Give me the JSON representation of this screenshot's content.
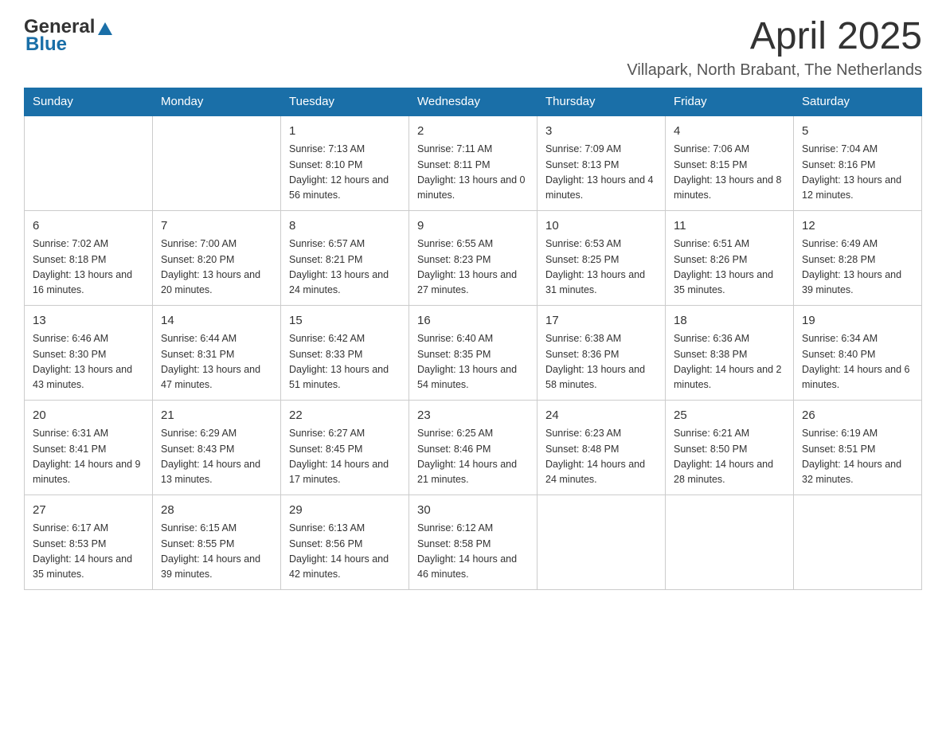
{
  "header": {
    "logo_general": "General",
    "logo_blue": "Blue",
    "month": "April 2025",
    "location": "Villapark, North Brabant, The Netherlands"
  },
  "days_of_week": [
    "Sunday",
    "Monday",
    "Tuesday",
    "Wednesday",
    "Thursday",
    "Friday",
    "Saturday"
  ],
  "weeks": [
    [
      {
        "day": "",
        "sunrise": "",
        "sunset": "",
        "daylight": ""
      },
      {
        "day": "",
        "sunrise": "",
        "sunset": "",
        "daylight": ""
      },
      {
        "day": "1",
        "sunrise": "Sunrise: 7:13 AM",
        "sunset": "Sunset: 8:10 PM",
        "daylight": "Daylight: 12 hours and 56 minutes."
      },
      {
        "day": "2",
        "sunrise": "Sunrise: 7:11 AM",
        "sunset": "Sunset: 8:11 PM",
        "daylight": "Daylight: 13 hours and 0 minutes."
      },
      {
        "day": "3",
        "sunrise": "Sunrise: 7:09 AM",
        "sunset": "Sunset: 8:13 PM",
        "daylight": "Daylight: 13 hours and 4 minutes."
      },
      {
        "day": "4",
        "sunrise": "Sunrise: 7:06 AM",
        "sunset": "Sunset: 8:15 PM",
        "daylight": "Daylight: 13 hours and 8 minutes."
      },
      {
        "day": "5",
        "sunrise": "Sunrise: 7:04 AM",
        "sunset": "Sunset: 8:16 PM",
        "daylight": "Daylight: 13 hours and 12 minutes."
      }
    ],
    [
      {
        "day": "6",
        "sunrise": "Sunrise: 7:02 AM",
        "sunset": "Sunset: 8:18 PM",
        "daylight": "Daylight: 13 hours and 16 minutes."
      },
      {
        "day": "7",
        "sunrise": "Sunrise: 7:00 AM",
        "sunset": "Sunset: 8:20 PM",
        "daylight": "Daylight: 13 hours and 20 minutes."
      },
      {
        "day": "8",
        "sunrise": "Sunrise: 6:57 AM",
        "sunset": "Sunset: 8:21 PM",
        "daylight": "Daylight: 13 hours and 24 minutes."
      },
      {
        "day": "9",
        "sunrise": "Sunrise: 6:55 AM",
        "sunset": "Sunset: 8:23 PM",
        "daylight": "Daylight: 13 hours and 27 minutes."
      },
      {
        "day": "10",
        "sunrise": "Sunrise: 6:53 AM",
        "sunset": "Sunset: 8:25 PM",
        "daylight": "Daylight: 13 hours and 31 minutes."
      },
      {
        "day": "11",
        "sunrise": "Sunrise: 6:51 AM",
        "sunset": "Sunset: 8:26 PM",
        "daylight": "Daylight: 13 hours and 35 minutes."
      },
      {
        "day": "12",
        "sunrise": "Sunrise: 6:49 AM",
        "sunset": "Sunset: 8:28 PM",
        "daylight": "Daylight: 13 hours and 39 minutes."
      }
    ],
    [
      {
        "day": "13",
        "sunrise": "Sunrise: 6:46 AM",
        "sunset": "Sunset: 8:30 PM",
        "daylight": "Daylight: 13 hours and 43 minutes."
      },
      {
        "day": "14",
        "sunrise": "Sunrise: 6:44 AM",
        "sunset": "Sunset: 8:31 PM",
        "daylight": "Daylight: 13 hours and 47 minutes."
      },
      {
        "day": "15",
        "sunrise": "Sunrise: 6:42 AM",
        "sunset": "Sunset: 8:33 PM",
        "daylight": "Daylight: 13 hours and 51 minutes."
      },
      {
        "day": "16",
        "sunrise": "Sunrise: 6:40 AM",
        "sunset": "Sunset: 8:35 PM",
        "daylight": "Daylight: 13 hours and 54 minutes."
      },
      {
        "day": "17",
        "sunrise": "Sunrise: 6:38 AM",
        "sunset": "Sunset: 8:36 PM",
        "daylight": "Daylight: 13 hours and 58 minutes."
      },
      {
        "day": "18",
        "sunrise": "Sunrise: 6:36 AM",
        "sunset": "Sunset: 8:38 PM",
        "daylight": "Daylight: 14 hours and 2 minutes."
      },
      {
        "day": "19",
        "sunrise": "Sunrise: 6:34 AM",
        "sunset": "Sunset: 8:40 PM",
        "daylight": "Daylight: 14 hours and 6 minutes."
      }
    ],
    [
      {
        "day": "20",
        "sunrise": "Sunrise: 6:31 AM",
        "sunset": "Sunset: 8:41 PM",
        "daylight": "Daylight: 14 hours and 9 minutes."
      },
      {
        "day": "21",
        "sunrise": "Sunrise: 6:29 AM",
        "sunset": "Sunset: 8:43 PM",
        "daylight": "Daylight: 14 hours and 13 minutes."
      },
      {
        "day": "22",
        "sunrise": "Sunrise: 6:27 AM",
        "sunset": "Sunset: 8:45 PM",
        "daylight": "Daylight: 14 hours and 17 minutes."
      },
      {
        "day": "23",
        "sunrise": "Sunrise: 6:25 AM",
        "sunset": "Sunset: 8:46 PM",
        "daylight": "Daylight: 14 hours and 21 minutes."
      },
      {
        "day": "24",
        "sunrise": "Sunrise: 6:23 AM",
        "sunset": "Sunset: 8:48 PM",
        "daylight": "Daylight: 14 hours and 24 minutes."
      },
      {
        "day": "25",
        "sunrise": "Sunrise: 6:21 AM",
        "sunset": "Sunset: 8:50 PM",
        "daylight": "Daylight: 14 hours and 28 minutes."
      },
      {
        "day": "26",
        "sunrise": "Sunrise: 6:19 AM",
        "sunset": "Sunset: 8:51 PM",
        "daylight": "Daylight: 14 hours and 32 minutes."
      }
    ],
    [
      {
        "day": "27",
        "sunrise": "Sunrise: 6:17 AM",
        "sunset": "Sunset: 8:53 PM",
        "daylight": "Daylight: 14 hours and 35 minutes."
      },
      {
        "day": "28",
        "sunrise": "Sunrise: 6:15 AM",
        "sunset": "Sunset: 8:55 PM",
        "daylight": "Daylight: 14 hours and 39 minutes."
      },
      {
        "day": "29",
        "sunrise": "Sunrise: 6:13 AM",
        "sunset": "Sunset: 8:56 PM",
        "daylight": "Daylight: 14 hours and 42 minutes."
      },
      {
        "day": "30",
        "sunrise": "Sunrise: 6:12 AM",
        "sunset": "Sunset: 8:58 PM",
        "daylight": "Daylight: 14 hours and 46 minutes."
      },
      {
        "day": "",
        "sunrise": "",
        "sunset": "",
        "daylight": ""
      },
      {
        "day": "",
        "sunrise": "",
        "sunset": "",
        "daylight": ""
      },
      {
        "day": "",
        "sunrise": "",
        "sunset": "",
        "daylight": ""
      }
    ]
  ]
}
